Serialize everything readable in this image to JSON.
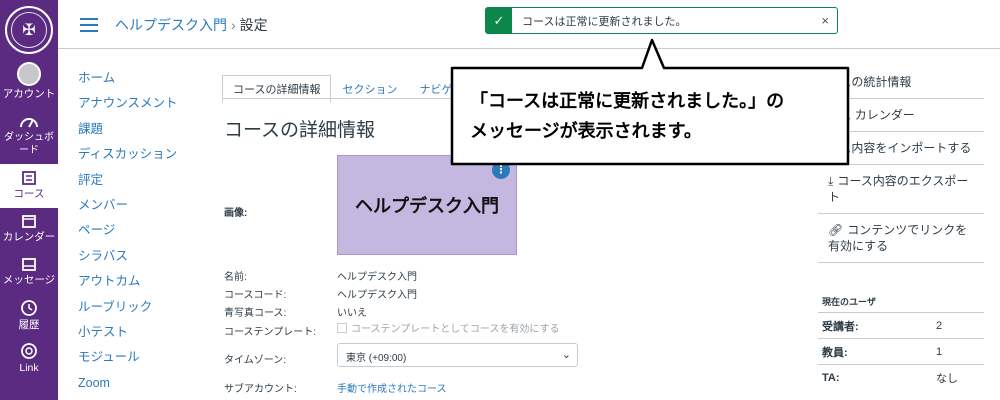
{
  "global_nav": {
    "logo_icon": "university-seal",
    "items": [
      {
        "label": "アカウント",
        "icon": "avatar"
      },
      {
        "label": "ダッシュボード",
        "icon": "dashboard-icon"
      },
      {
        "label": "コース",
        "icon": "courses-icon"
      },
      {
        "label": "カレンダー",
        "icon": "calendar-icon"
      },
      {
        "label": "メッセージ",
        "icon": "inbox-icon"
      },
      {
        "label": "履歴",
        "icon": "history-icon"
      },
      {
        "label": "Link",
        "icon": "help-icon"
      }
    ]
  },
  "header": {
    "breadcrumb_course": "ヘルプデスク入門",
    "breadcrumb_sep": "›",
    "breadcrumb_current": "設定"
  },
  "course_nav": [
    "ホーム",
    "アナウンスメント",
    "課題",
    "ディスカッション",
    "評定",
    "メンバー",
    "ページ",
    "シラバス",
    "アウトカム",
    "ルーブリック",
    "小テスト",
    "モジュール",
    "Zoom"
  ],
  "tabs": [
    "コースの詳細情報",
    "セクション",
    "ナビゲー"
  ],
  "main": {
    "title": "コースの詳細情報",
    "image_label": "画像:",
    "image_text": "ヘルプデスク入門",
    "kebab": "⋮",
    "fields": [
      {
        "label": "名前:",
        "value": "ヘルプデスク入門"
      },
      {
        "label": "コースコード:",
        "value": "ヘルプデスク入門"
      },
      {
        "label": "青写真コース:",
        "value": "いいえ"
      },
      {
        "label": "コーステンプレート:",
        "value": "コーステンプレートとしてコースを有効にする"
      },
      {
        "label": "タイムゾーン:",
        "value": "東京 (+09:00)"
      },
      {
        "label": "サブアカウント:",
        "value": "手動で作成されたコース"
      }
    ]
  },
  "right_sidebar": {
    "links": [
      {
        "label": "ースの統計情報",
        "icon": ""
      },
      {
        "label": "ース カレンダー",
        "icon": ""
      },
      {
        "label": "ース内容をインポートする",
        "icon": ""
      },
      {
        "label": "コース内容のエクスポート",
        "icon": "download-icon"
      },
      {
        "label": "コンテンツでリンクを有効にする",
        "icon": "link-icon"
      }
    ],
    "users_title": "現在のユーザ",
    "users": [
      {
        "role": "受講者:",
        "count": "2"
      },
      {
        "role": "教員:",
        "count": "1"
      },
      {
        "role": "TA:",
        "count": "なし"
      }
    ]
  },
  "flash": {
    "message": "コースは正常に更新されました。",
    "check": "✓",
    "close": "×"
  },
  "callout": {
    "line1": "「コースは正常に更新されました。」の",
    "line2": "メッセージが表示されます。"
  },
  "colors": {
    "nav_bg": "#5b2b82",
    "link": "#2b7abc",
    "success": "#0b874b",
    "image_bg": "#c5b8e0"
  }
}
